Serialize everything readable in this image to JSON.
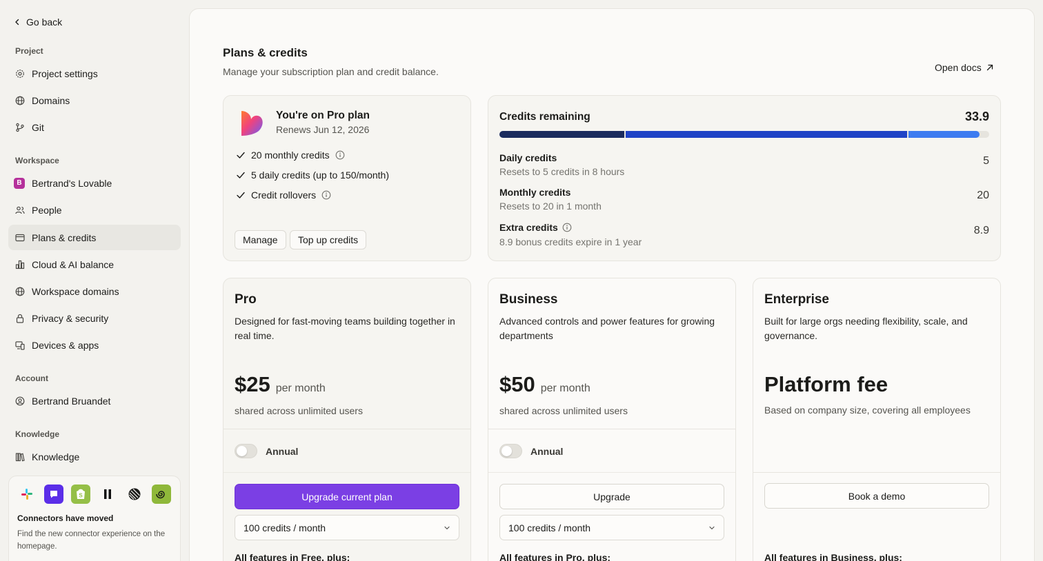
{
  "sidebar": {
    "back_label": "Go back",
    "sections": {
      "project": "Project",
      "workspace": "Workspace",
      "account": "Account",
      "knowledge": "Knowledge"
    },
    "items": {
      "project_settings": "Project settings",
      "domains": "Domains",
      "git": "Git",
      "workspace_name": "Bertrand's Lovable",
      "workspace_initial": "B",
      "people": "People",
      "plans_credits": "Plans & credits",
      "cloud_ai": "Cloud & AI balance",
      "workspace_domains": "Workspace domains",
      "privacy": "Privacy & security",
      "devices": "Devices & apps",
      "user_name": "Bertrand Bruandet",
      "knowledge": "Knowledge"
    },
    "connectors": {
      "title": "Connectors have moved",
      "description": "Find the new connector experience on the homepage."
    }
  },
  "header": {
    "title": "Plans & credits",
    "subtitle": "Manage your subscription plan and credit balance.",
    "docs_label": "Open docs"
  },
  "current_plan": {
    "title": "You're on Pro plan",
    "renews": "Renews Jun 12, 2026",
    "features": [
      "20 monthly credits",
      "5 daily credits (up to 150/month)",
      "Credit rollovers"
    ],
    "manage_label": "Manage",
    "topup_label": "Top up credits"
  },
  "credits": {
    "title": "Credits remaining",
    "total": "33.9",
    "bar_fractions": [
      0.255,
      0.575,
      0.145
    ],
    "bar_colors": [
      "#1a2b5e",
      "#1f43c6",
      "#3d7bf0"
    ],
    "rows": [
      {
        "label": "Daily credits",
        "sub": "Resets to 5 credits in 8 hours",
        "value": "5"
      },
      {
        "label": "Monthly credits",
        "sub": "Resets to 20 in 1 month",
        "value": "20"
      },
      {
        "label": "Extra credits",
        "sub": "8.9 bonus credits expire in 1 year",
        "value": "8.9"
      }
    ]
  },
  "tiers": [
    {
      "name": "Pro",
      "description": "Designed for fast-moving teams building together in real time.",
      "price": "$25",
      "period": "per month",
      "note": "shared across unlimited users",
      "toggle_label": "Annual",
      "button_label": "Upgrade current plan",
      "select_value": "100 credits / month",
      "features_heading": "All features in Free, plus:"
    },
    {
      "name": "Business",
      "description": "Advanced controls and power features for growing departments",
      "price": "$50",
      "period": "per month",
      "note": "shared across unlimited users",
      "toggle_label": "Annual",
      "button_label": "Upgrade",
      "select_value": "100 credits / month",
      "features_heading": "All features in Pro, plus:"
    },
    {
      "name": "Enterprise",
      "description": "Built for large orgs needing flexibility, scale, and governance.",
      "price": "Platform fee",
      "note": "Based on company size, covering all employees",
      "button_label": "Book a demo",
      "features_heading": "All features in Business, plus:"
    }
  ],
  "colors": {
    "accent": "#7b3fe4",
    "background": "#f3f2ee",
    "panel": "#fbfaf8",
    "card": "#f6f5f1"
  }
}
